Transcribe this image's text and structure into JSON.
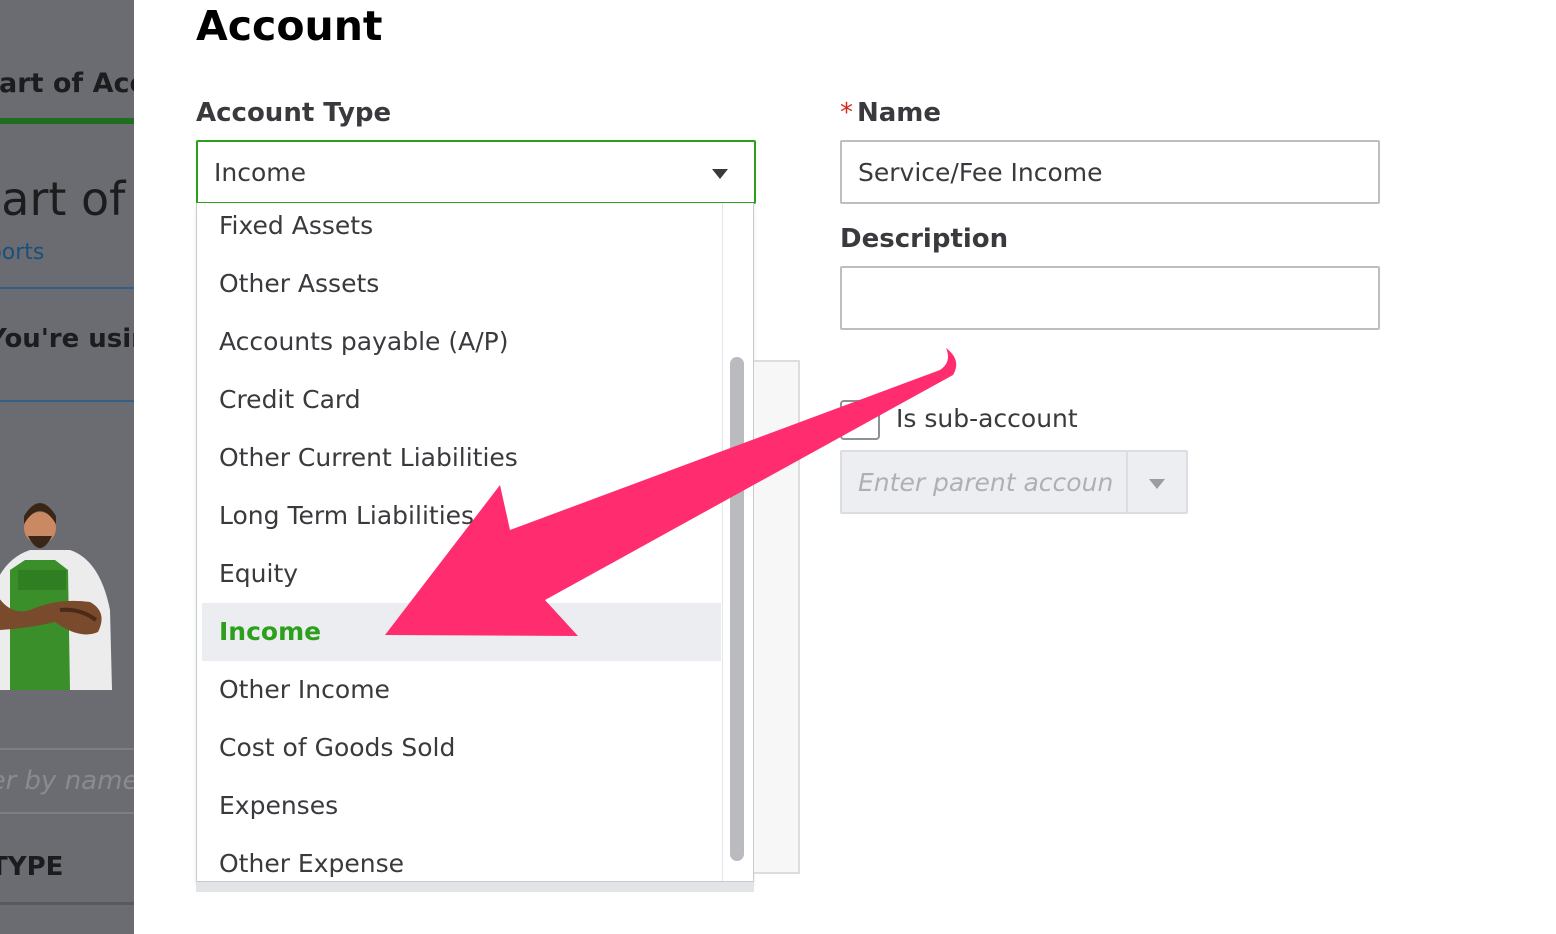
{
  "background_page": {
    "tab_label": "Chart of Accounts",
    "heading": "Chart of Accounts",
    "link_text": "Reports",
    "using_text": "You're using",
    "filter_placeholder": "Filter by name",
    "column_header": "TYPE"
  },
  "panel": {
    "title": "Account"
  },
  "account_type": {
    "label": "Account Type",
    "selected_value": "Income",
    "options": [
      "Fixed Assets",
      "Other Assets",
      "Accounts payable (A/P)",
      "Credit Card",
      "Other Current Liabilities",
      "Long Term Liabilities",
      "Equity",
      "Income",
      "Other Income",
      "Cost of Goods Sold",
      "Expenses",
      "Other Expense"
    ]
  },
  "name_field": {
    "required_marker": "*",
    "label": "Name",
    "value": "Service/Fee Income"
  },
  "description_field": {
    "label": "Description",
    "value": ""
  },
  "sub_account": {
    "label": "Is sub-account",
    "checked": false
  },
  "parent_account": {
    "placeholder": "Enter parent account"
  },
  "colors": {
    "accent_green": "#2ca01c",
    "annotation_pink": "#ff2d6f",
    "required_red": "#d52b1e"
  },
  "icons": {
    "select_caret": "caret-down-icon",
    "annotation": "arrow-icon"
  }
}
